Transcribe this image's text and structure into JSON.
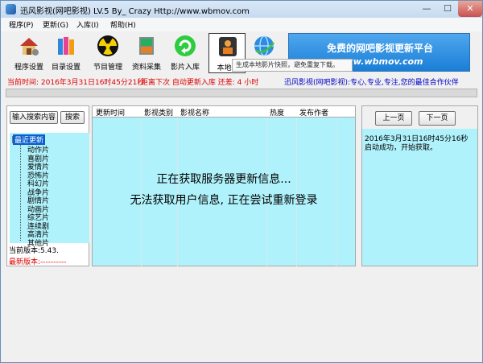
{
  "window": {
    "title": "迅风影视(网吧影视) LV.5 By_ Crazy Http://www.wbmov.com",
    "min": "—",
    "max": "☐",
    "close": "✕"
  },
  "menu": [
    "程序(P)",
    "更新(G)",
    "入库(I)",
    "帮助(H)"
  ],
  "toolbar": [
    {
      "label": "程序设置",
      "icon": "house-gear-icon"
    },
    {
      "label": "目录设置",
      "icon": "books-icon"
    },
    {
      "label": "节目管理",
      "icon": "radiation-icon"
    },
    {
      "label": "资料采集",
      "icon": "album-icon"
    },
    {
      "label": "影片入库",
      "icon": "refresh-icon"
    },
    {
      "label": "本地快",
      "icon": "person-icon"
    },
    {
      "label": "",
      "icon": "globe-icon"
    }
  ],
  "tooltip": "生成本地影片快照，避免重复下载。",
  "banner": {
    "title": "免费的网吧影视更新平台",
    "url": "www.wbmov.com"
  },
  "status": {
    "current_time": "当前时间: 2016年3月31日16时45分21秒",
    "next_update": "距离下次 自动更新入库 还差: 4 小时",
    "slogan": "迅风影视(网吧影视):专心,专业,专注,您的最佳合作伙伴"
  },
  "left": {
    "search_btn": "输入搜索内容",
    "search_go": "搜索",
    "tree_root": "最近更新",
    "tree_items": [
      "动作片",
      "喜剧片",
      "爱情片",
      "恐怖片",
      "科幻片",
      "战争片",
      "剧情片",
      "动画片",
      "综艺片",
      "连续剧",
      "高清片",
      "其他片"
    ],
    "current_version": "当前版本:5.43.",
    "latest_version": "最新版本:----------"
  },
  "center": {
    "columns": [
      "更新时间",
      "影视类别",
      "影视名称",
      "热度",
      "发布作者"
    ],
    "msg1": "正在获取服务器更新信息...",
    "msg2": "无法获取用户信息, 正在尝试重新登录"
  },
  "right": {
    "prev": "上一页",
    "next": "下一页",
    "log1": "2016年3月31日16时45分16秒",
    "log2": "启动成功，开始获取。"
  },
  "colors": {
    "accent_cyan": "#b0f2fb",
    "status_red": "#e00000",
    "status_blue": "#0000c8"
  }
}
